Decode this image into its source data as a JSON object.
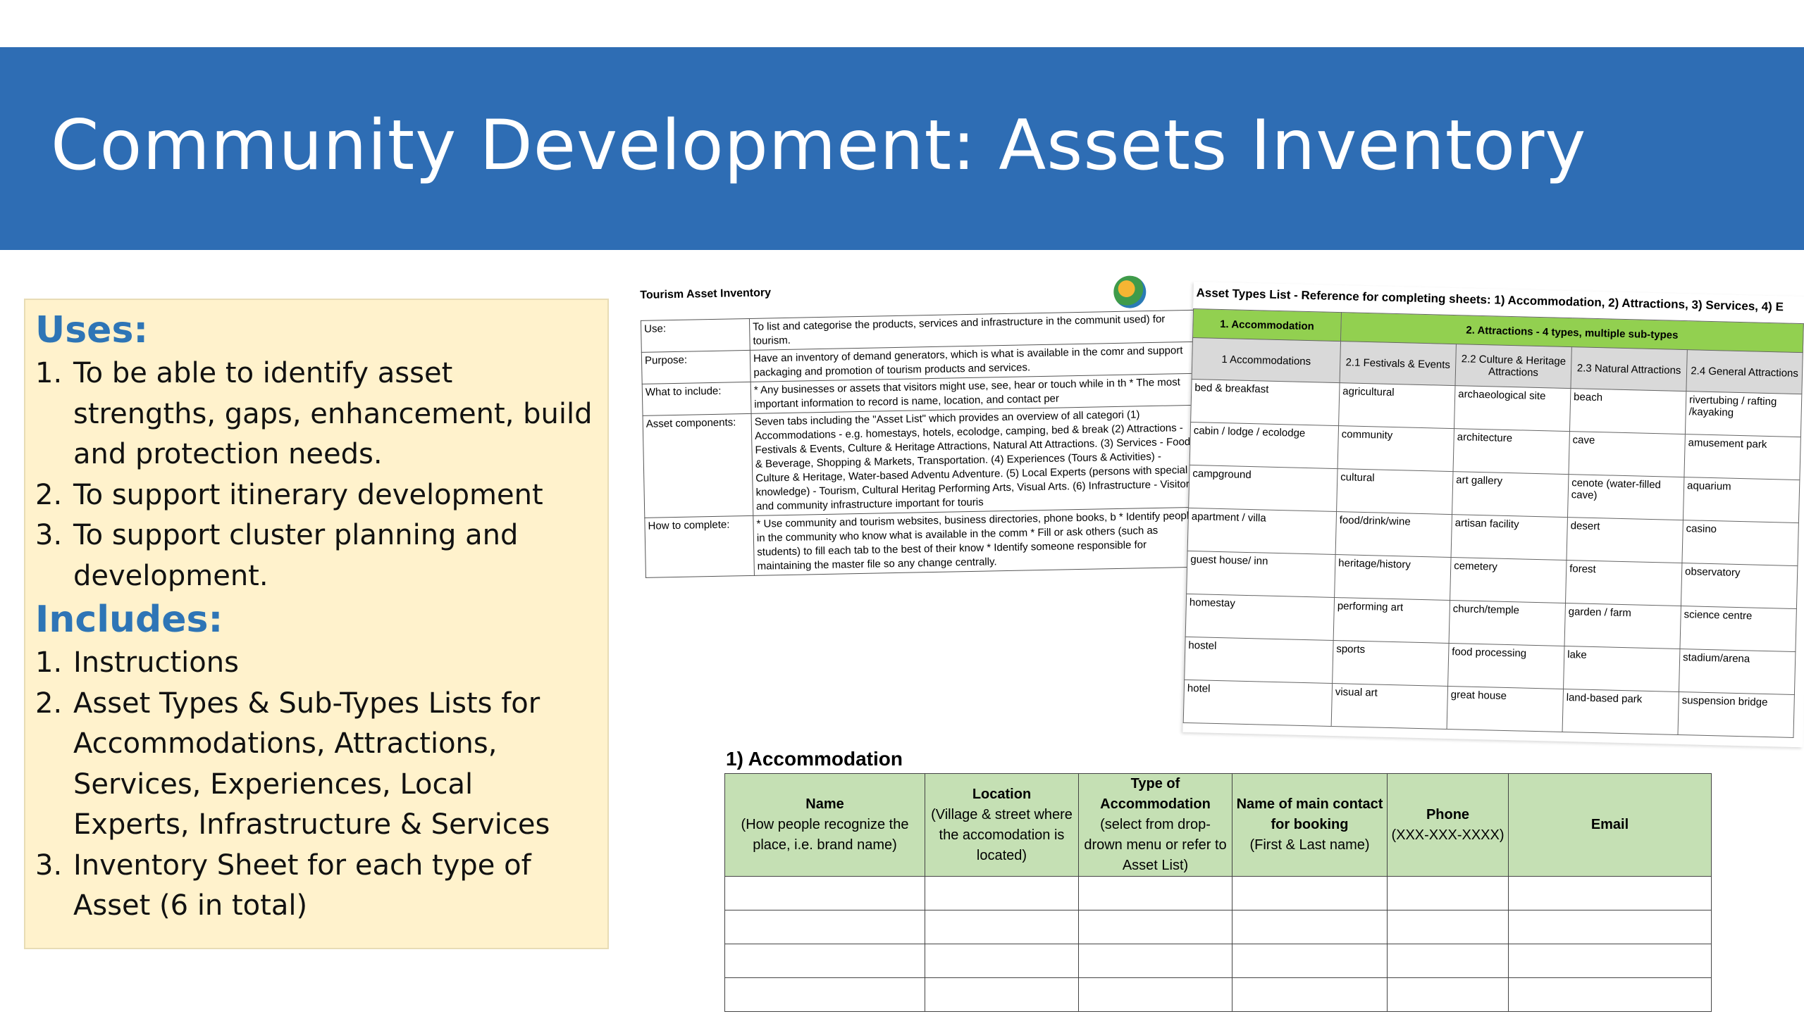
{
  "slide": {
    "title": "Community Development: Assets Inventory"
  },
  "panel": {
    "uses_heading": "Uses:",
    "uses": [
      "To be able to identify asset strengths, gaps, enhancement, build and protection needs.",
      "To support itinerary development",
      "To support cluster planning and development."
    ],
    "includes_heading": "Includes:",
    "includes": [
      "Instructions",
      "Asset Types & Sub-Types Lists for Accommodations, Attractions, Services, Experiences, Local Experts, Infrastructure & Services",
      "Inventory Sheet for each type of Asset (6 in total)"
    ]
  },
  "instructions_sheet": {
    "title": "Tourism Asset Inventory",
    "rows": [
      {
        "key": "Use:",
        "value": "To list and categorise the products, services and infrastructure in the communit used) for tourism."
      },
      {
        "key": "Purpose:",
        "value": "Have an inventory of demand generators, which is what is available in the comr and support packaging and promotion of tourism products and services."
      },
      {
        "key": "What to include:",
        "value": "* Any businesses or assets that visitors might use, see, hear or touch while in th * The most important information to record is name, location, and contact per"
      },
      {
        "key": "Asset components:",
        "value": "Seven tabs including the \"Asset List\" which provides an overview of all categori (1) Accommodations - e.g. homestays, hotels, ecolodge, camping, bed & break (2) Attractions - Festivals & Events, Culture & Heritage Attractions, Natural Att Attractions. (3) Services - Food & Beverage, Shopping & Markets, Transportation. (4) Experiences (Tours & Activities) - Culture & Heritage, Water-based Adventu Adventure. (5) Local Experts (persons with special knowledge) - Tourism, Cultural Heritag Performing Arts, Visual Arts. (6) Infrastructure - Visitor and community infrastructure important for touris"
      },
      {
        "key": "How to complete:",
        "value": "* Use community and tourism websites, business directories, phone books, b * Identify people in the community who know what is available in the comm * Fill or ask others (such as students) to fill each tab to the best of their know * Identify someone responsible for maintaining the master file so any change centrally."
      }
    ]
  },
  "asset_types_sheet": {
    "title": "Asset Types List - Reference for completing sheets: 1) Accommodation, 2) Attractions, 3) Services, 4) E",
    "group_headers": [
      "1. Accommodation",
      "2. Attractions - 4 types, multiple sub-types"
    ],
    "column_headers": [
      "1 Accommodations",
      "2.1 Festivals & Events",
      "2.2 Culture & Heritage Attractions",
      "2.3 Natural Attractions",
      "2.4 General Attractions"
    ],
    "rows": [
      [
        "bed & breakfast",
        "agricultural",
        "archaeological site",
        "beach",
        "rivertubing / rafting /kayaking"
      ],
      [
        "cabin / lodge / ecolodge",
        "community",
        "architecture",
        "cave",
        "amusement park"
      ],
      [
        "campground",
        "cultural",
        "art gallery",
        "cenote (water-filled cave)",
        "aquarium"
      ],
      [
        "apartment / villa",
        "food/drink/wine",
        "artisan facility",
        "desert",
        "casino"
      ],
      [
        "guest house/ inn",
        "heritage/history",
        "cemetery",
        "forest",
        "observatory"
      ],
      [
        "homestay",
        "performing art",
        "church/temple",
        "garden / farm",
        "science centre"
      ],
      [
        "hostel",
        "sports",
        "food processing",
        "lake",
        "stadium/arena"
      ],
      [
        "hotel",
        "visual art",
        "great house",
        "land-based park",
        "suspension bridge"
      ]
    ]
  },
  "accommodation_form": {
    "title": "1) Accommodation",
    "columns": [
      {
        "main": "Name",
        "sub": "(How people recognize the place, i.e. brand name)"
      },
      {
        "main": "Location",
        "sub": "(Village & street where the accomodation is located)"
      },
      {
        "main": "Type of Accommodation",
        "sub": "(select from drop- drown menu or refer to Asset List)"
      },
      {
        "main": "Name of main contact for booking",
        "sub": "(First & Last name)"
      },
      {
        "main": "Phone",
        "sub": "(XXX-XXX-XXXX)"
      },
      {
        "main": "Email",
        "sub": ""
      }
    ],
    "empty_rows": 4
  }
}
